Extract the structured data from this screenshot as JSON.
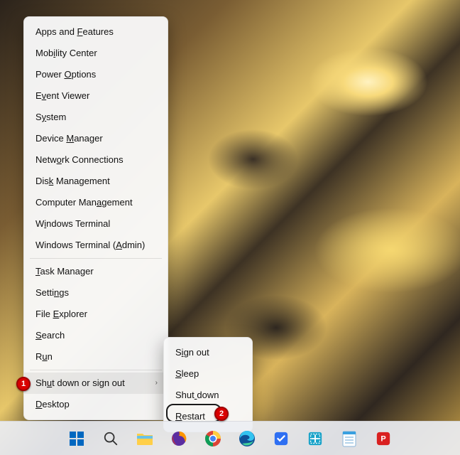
{
  "main_menu": {
    "items": [
      {
        "label": "Apps and Features",
        "ul": 9
      },
      {
        "label": "Mobility Center",
        "ul": 3
      },
      {
        "label": "Power Options",
        "ul": 6
      },
      {
        "label": "Event Viewer",
        "ul": 1
      },
      {
        "label": "System",
        "ul": 1
      },
      {
        "label": "Device Manager",
        "ul": 7
      },
      {
        "label": "Network Connections",
        "ul": 4
      },
      {
        "label": "Disk Management",
        "ul": 3
      },
      {
        "label": "Computer Management",
        "ul": 12
      },
      {
        "label": "Windows Terminal",
        "ul": 1
      },
      {
        "label": "Windows Terminal (Admin)",
        "ul": 18
      },
      {
        "sep": true
      },
      {
        "label": "Task Manager",
        "ul": 0
      },
      {
        "label": "Settings",
        "ul": 5
      },
      {
        "label": "File Explorer",
        "ul": 5
      },
      {
        "label": "Search",
        "ul": 0
      },
      {
        "label": "Run",
        "ul": 1
      },
      {
        "sep": true
      },
      {
        "label": "Shut down or sign out",
        "ul": 2,
        "submenu": true,
        "hovered": true
      },
      {
        "label": "Desktop",
        "ul": 0
      }
    ]
  },
  "sub_menu": {
    "items": [
      {
        "label": "Sign out",
        "ul": 1
      },
      {
        "label": "Sleep",
        "ul": 0
      },
      {
        "label": "Shut down",
        "ul": 4
      },
      {
        "label": "Restart",
        "ul": 0
      }
    ]
  },
  "annotations": {
    "badge1": "1",
    "badge2": "2"
  },
  "taskbar": {
    "items": [
      {
        "name": "start-button"
      },
      {
        "name": "search-button"
      },
      {
        "name": "file-explorer"
      },
      {
        "name": "firefox"
      },
      {
        "name": "chrome"
      },
      {
        "name": "edge"
      },
      {
        "name": "todo-app"
      },
      {
        "name": "screenshot-app"
      },
      {
        "name": "notepad"
      },
      {
        "name": "pdf-app"
      }
    ]
  }
}
